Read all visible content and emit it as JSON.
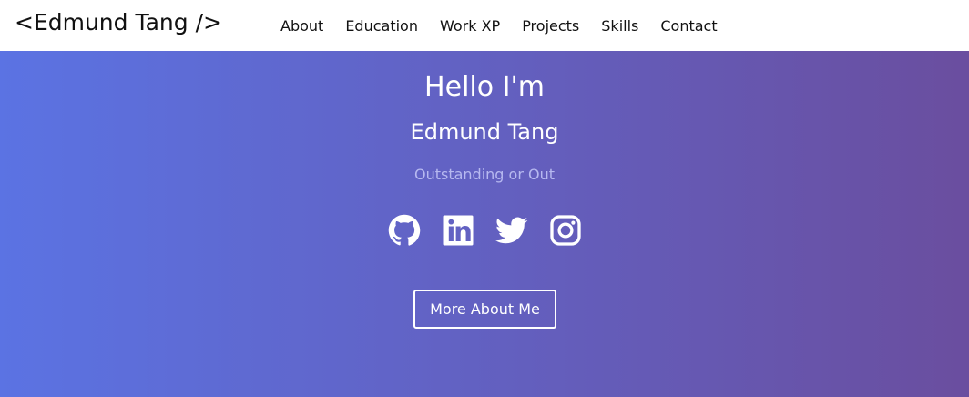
{
  "navbar": {
    "brand": "<Edmund Tang />",
    "links": [
      "About",
      "Education",
      "Work XP",
      "Projects",
      "Skills",
      "Contact"
    ]
  },
  "hero": {
    "greeting": "Hello I'm",
    "name": "Edmund Tang",
    "tagline": "Outstanding or Out",
    "socials": [
      {
        "icon": "github-icon"
      },
      {
        "icon": "linkedin-icon"
      },
      {
        "icon": "twitter-icon"
      },
      {
        "icon": "instagram-icon"
      }
    ],
    "cta_label": "More About Me"
  },
  "colors": {
    "gradient_start": "#5b73e3",
    "gradient_end": "#6a4e9f",
    "tagline": "#b7b9f0",
    "nav_text": "#111111"
  }
}
